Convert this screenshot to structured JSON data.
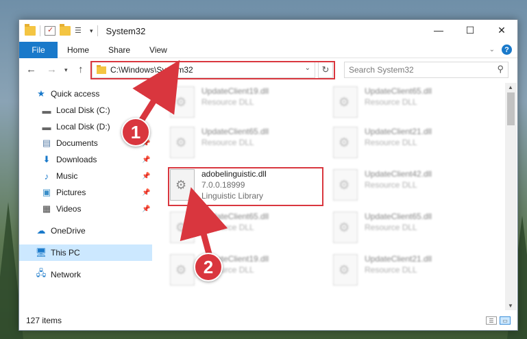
{
  "window": {
    "title": "System32",
    "controls": [
      "—",
      "☐",
      "✕"
    ]
  },
  "ribbon": {
    "tabs": [
      "File",
      "Home",
      "Share",
      "View"
    ],
    "help": "?"
  },
  "nav": {
    "address": "C:\\Windows\\System32",
    "search_placeholder": "Search System32"
  },
  "sidebar": {
    "items": [
      {
        "label": "Quick access",
        "icon": "star-icon",
        "pinned": false
      },
      {
        "label": "Local Disk (C:)",
        "icon": "drive-icon",
        "pinned": false
      },
      {
        "label": "Local Disk (D:)",
        "icon": "drive-icon",
        "pinned": false
      },
      {
        "label": "Documents",
        "icon": "documents-icon",
        "pinned": true
      },
      {
        "label": "Downloads",
        "icon": "download-icon",
        "pinned": true
      },
      {
        "label": "Music",
        "icon": "music-icon",
        "pinned": true
      },
      {
        "label": "Pictures",
        "icon": "pictures-icon",
        "pinned": true
      },
      {
        "label": "Videos",
        "icon": "video-icon",
        "pinned": true
      },
      {
        "label": "OneDrive",
        "icon": "cloud-icon",
        "pinned": false
      },
      {
        "label": "This PC",
        "icon": "computer-icon",
        "pinned": false
      },
      {
        "label": "Network",
        "icon": "network-icon",
        "pinned": false
      }
    ]
  },
  "files": {
    "blurred": [
      {
        "name": "UpdateClient19.dll",
        "sub": "Resource DLL"
      },
      {
        "name": "UpdateClient65.dll",
        "sub": "Resource DLL"
      },
      {
        "name": "UpdateClient65.dll",
        "sub": "Resource DLL"
      },
      {
        "name": "UpdateClient21.dll",
        "sub": "Resource DLL"
      },
      {
        "name": "UpdateClient42.dll",
        "sub": "Resource DLL"
      },
      {
        "name": "UpdateClient65.dll",
        "sub": "Resource DLL"
      },
      {
        "name": "UpdateClient65.dll",
        "sub": "Resource DLL"
      },
      {
        "name": "UpdateClient19.dll",
        "sub": "Resource DLL"
      },
      {
        "name": "UpdateClient21.dll",
        "sub": "Resource DLL"
      }
    ],
    "highlighted": {
      "name": "adobelinguistic.dll",
      "version": "7.0.0.18999",
      "description": "Linguistic Library"
    }
  },
  "status": {
    "count": "127 items"
  },
  "annotations": {
    "step1": "1",
    "step2": "2"
  },
  "colors": {
    "accent": "#1979ca",
    "highlight": "#d9363e",
    "selected": "#cce8ff"
  }
}
